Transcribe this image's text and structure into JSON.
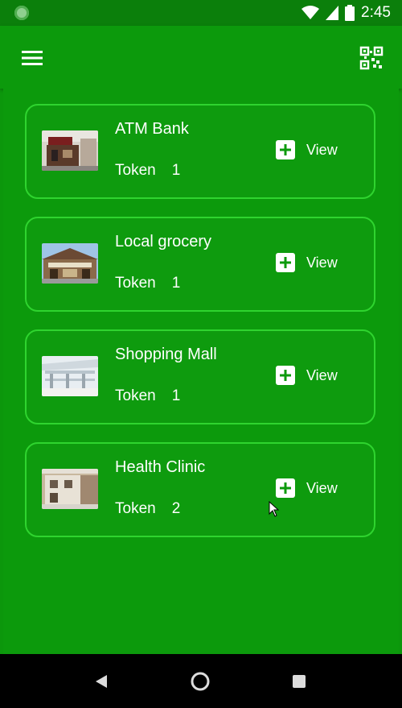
{
  "status_bar": {
    "time": "2:45"
  },
  "toolbar": {
    "menu_icon": "hamburger-menu-icon",
    "qr_icon": "qr-code-scan-icon"
  },
  "places": [
    {
      "title": "ATM Bank",
      "token_label": "Token",
      "token_value": "1",
      "action_label": "View"
    },
    {
      "title": "Local grocery",
      "token_label": "Token",
      "token_value": "1",
      "action_label": "View"
    },
    {
      "title": "Shopping Mall",
      "token_label": "Token",
      "token_value": "1",
      "action_label": "View"
    },
    {
      "title": "Health Clinic",
      "token_label": "Token",
      "token_value": "2",
      "action_label": "View"
    }
  ],
  "colors": {
    "background": "#0c9a0c",
    "card_border": "#2fd42f",
    "status_bar": "#0b7f0b",
    "text": "#ffffff"
  }
}
